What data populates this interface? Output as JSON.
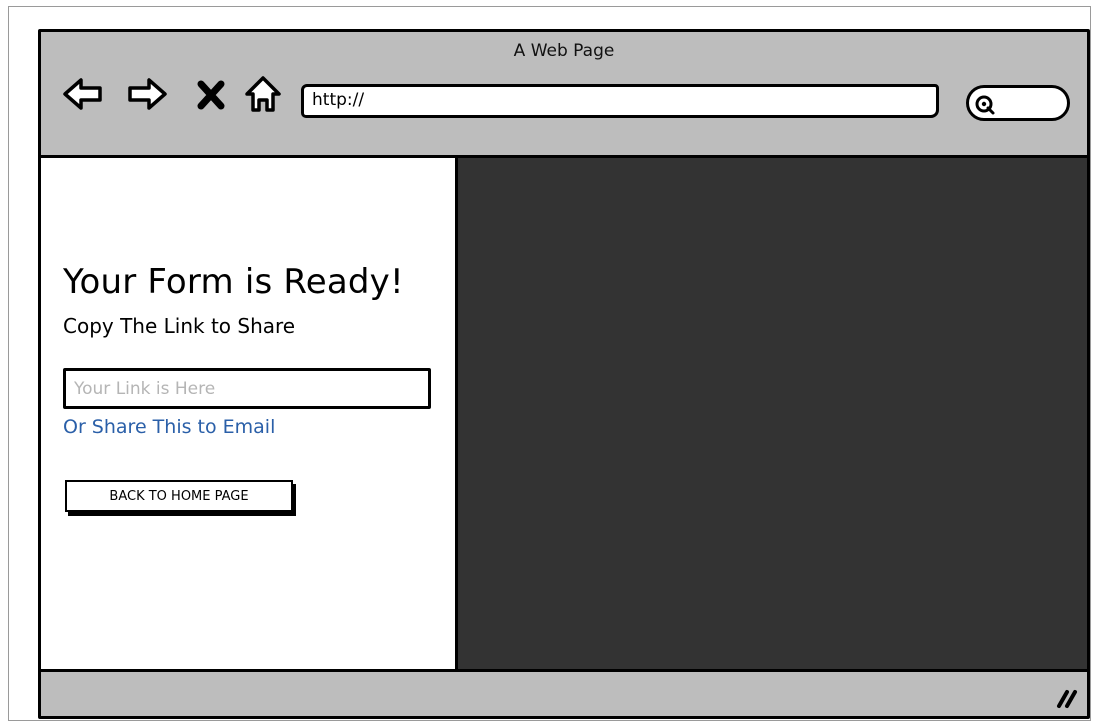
{
  "window": {
    "title": "A Web Page"
  },
  "toolbar": {
    "back_icon": "back-arrow-icon",
    "forward_icon": "forward-arrow-icon",
    "stop_icon": "close-x-icon",
    "home_icon": "home-icon",
    "url_value": "http://",
    "search_icon": "search-icon"
  },
  "main": {
    "heading": "Your Form is Ready!",
    "subheading": "Copy The Link to Share",
    "link_input_placeholder": "Your Link is Here",
    "share_link_label": "Or Share This to Email",
    "back_button_label": "BACK TO HOME PAGE"
  },
  "colors": {
    "chrome": "#bdbdbd",
    "image_panel": "#333333",
    "link": "#2a5fa8"
  }
}
